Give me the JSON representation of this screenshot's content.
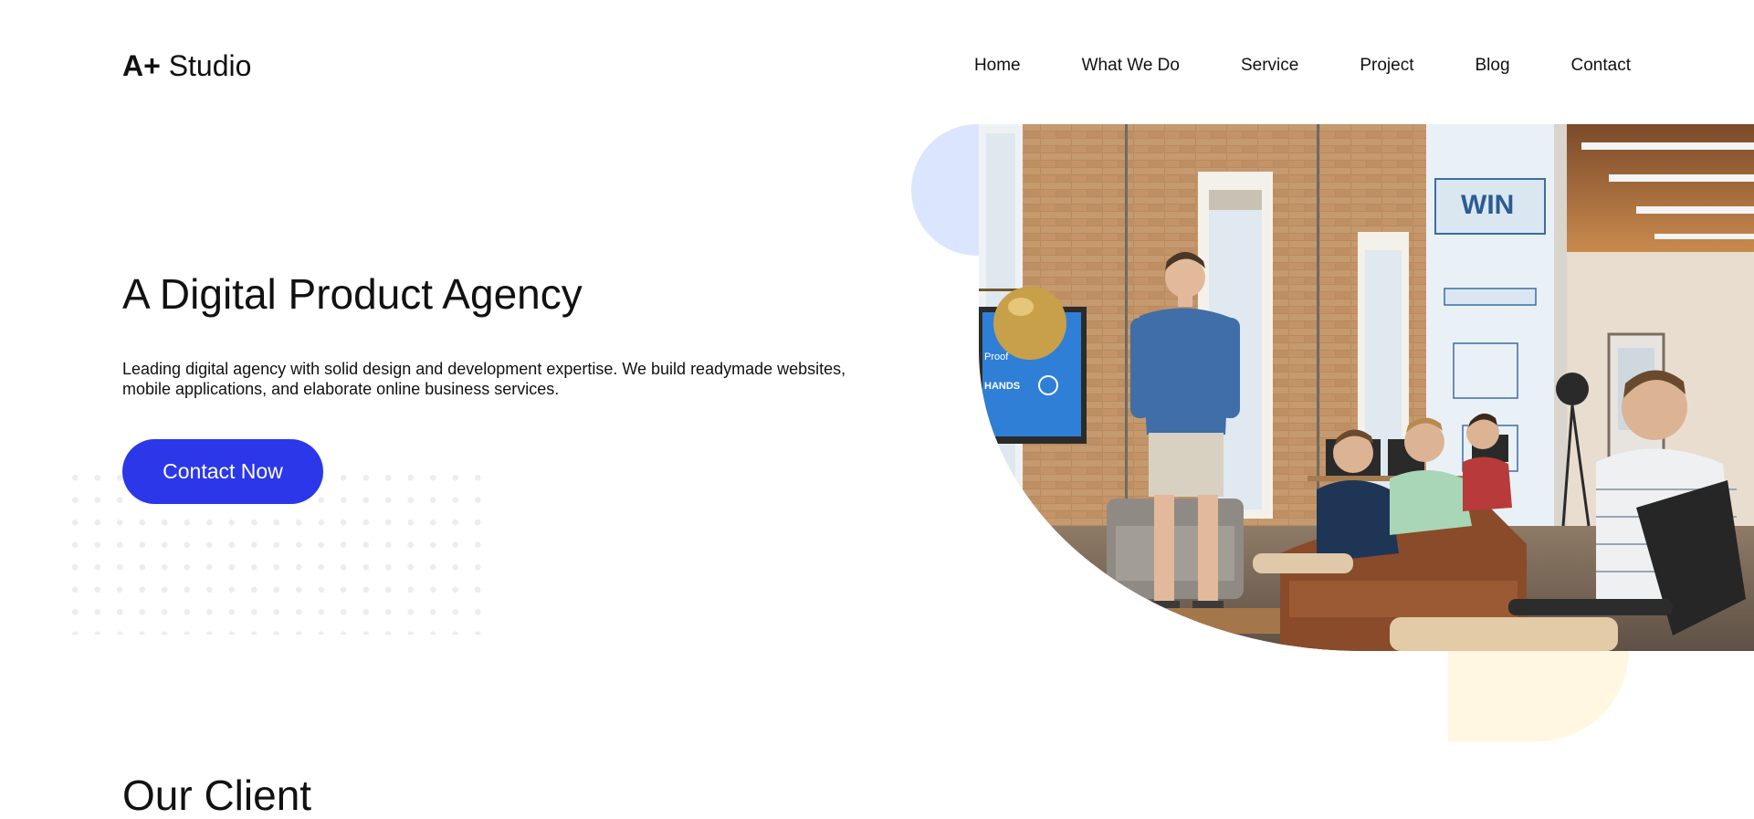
{
  "header": {
    "logo_mark": "A+",
    "logo_text": "Studio",
    "nav": [
      {
        "label": "Home"
      },
      {
        "label": "What We Do"
      },
      {
        "label": "Service"
      },
      {
        "label": "Project"
      },
      {
        "label": "Blog"
      },
      {
        "label": "Contact"
      }
    ]
  },
  "hero": {
    "title": "A Digital Product Agency",
    "description": "Leading digital agency with solid design and development expertise. We build readymade websites, mobile applications, and elaborate online business services.",
    "cta_label": "Contact Now",
    "image_alt": "Team presentation in a brick-walled office"
  },
  "sections": {
    "client_title": "Our Client"
  },
  "colors": {
    "accent": "#2b37e8",
    "decor_blue": "#dbe6fe",
    "decor_yellow": "#fff7e2"
  }
}
